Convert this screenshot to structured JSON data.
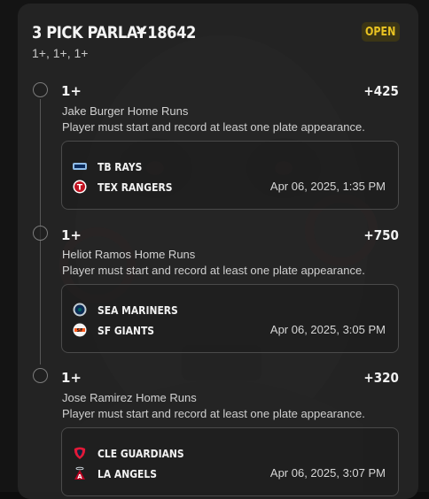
{
  "parlay": {
    "title": "3 PICK PARLAY",
    "odds": "+18642",
    "status": "OPEN",
    "lines_summary": "1+, 1+, 1+"
  },
  "legs": [
    {
      "line": "1+",
      "odds": "+425",
      "market": "Jake Burger Home Runs",
      "rule": "Player must start and record at least one plate appearance.",
      "teams": [
        {
          "name": "TB RAYS",
          "logo": "rays-logo-icon"
        },
        {
          "name": "TEX RANGERS",
          "logo": "rangers-logo-icon"
        }
      ],
      "game_time": "Apr 06, 2025, 1:35 PM"
    },
    {
      "line": "1+",
      "odds": "+750",
      "market": "Heliot Ramos Home Runs",
      "rule": "Player must start and record at least one plate appearance.",
      "teams": [
        {
          "name": "SEA MARINERS",
          "logo": "mariners-logo-icon"
        },
        {
          "name": "SF GIANTS",
          "logo": "giants-logo-icon"
        }
      ],
      "game_time": "Apr 06, 2025, 3:05 PM"
    },
    {
      "line": "1+",
      "odds": "+320",
      "market": "Jose Ramirez Home Runs",
      "rule": "Player must start and record at least one plate appearance.",
      "teams": [
        {
          "name": "CLE GUARDIANS",
          "logo": "guardians-logo-icon"
        },
        {
          "name": "LA ANGELS",
          "logo": "angels-logo-icon"
        }
      ],
      "game_time": "Apr 06, 2025, 3:07 PM"
    }
  ],
  "colors": {
    "status_badge_text": "#e9c322",
    "status_badge_bg": "#3b3516",
    "card_bg": "#262626"
  }
}
